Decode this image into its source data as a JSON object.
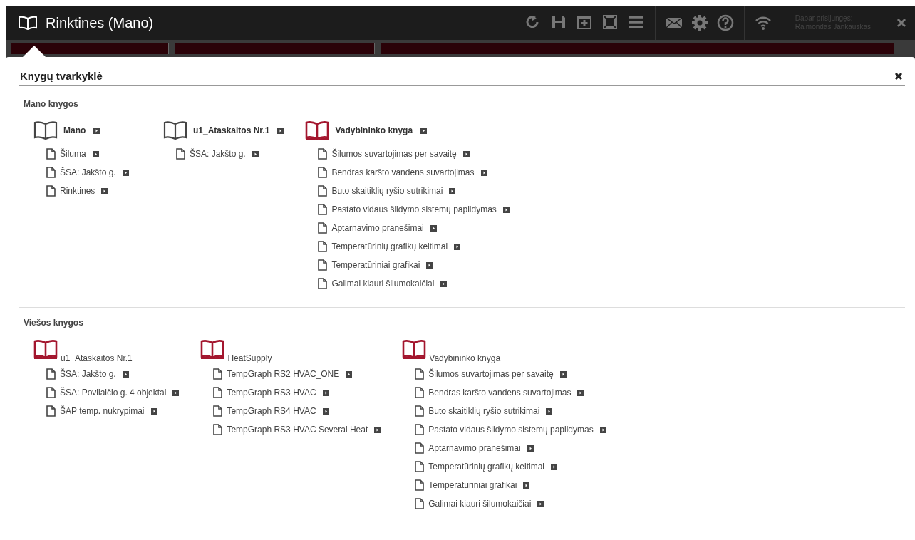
{
  "window": {
    "title": "Rinktines (Mano)"
  },
  "toolbar": {
    "buttons": [
      {
        "kind": "refresh"
      },
      {
        "kind": "save"
      },
      {
        "kind": "add"
      },
      {
        "kind": "fullscreen"
      },
      {
        "kind": "menu"
      },
      {
        "kind": "mail"
      },
      {
        "kind": "settings"
      },
      {
        "kind": "help"
      },
      {
        "kind": "wifi"
      }
    ],
    "user_label": "Dabar prisijungęs:",
    "user_name": "Raimondas Jankauskas"
  },
  "panel": {
    "title": "Knygų tvarkyklė",
    "sections": [
      {
        "title": "Mano knygos",
        "kind": "mine",
        "books": [
          {
            "title": "Mano",
            "kind": "plain",
            "pages": [
              "Šiluma",
              "ŠSA: Jakšto g.",
              "Rinktines"
            ]
          },
          {
            "title": "u1_Ataskaitos Nr.1",
            "kind": "plain",
            "pages": [
              "ŠSA: Jakšto g."
            ]
          },
          {
            "title": "Vadybininko knyga",
            "kind": "shared",
            "pages": [
              "Šilumos suvartojimas per savaitę",
              "Bendras karšto vandens suvartojimas",
              "Buto skaitiklių ryšio sutrikimai",
              "Pastato vidaus šildymo sistemų papildymas",
              "Aptarnavimo pranešimai",
              "Temperatūrinių grafikų keitimai",
              "Temperatūriniai grafikai",
              "Galimai kiauri šilumokaičiai"
            ]
          }
        ]
      },
      {
        "title": "Viešos knygos",
        "kind": "public",
        "books": [
          {
            "title": "u1_Ataskaitos Nr.1",
            "kind": "shared",
            "pages": [
              "ŠSA: Jakšto g.",
              "ŠSA: Povilaičio g. 4 objektai",
              "ŠAP temp. nukrypimai"
            ]
          },
          {
            "title": "HeatSupply",
            "kind": "shared",
            "pages": [
              "TempGraph RS2 HVAC_ONE",
              "TempGraph RS3 HVAC",
              "TempGraph RS4 HVAC",
              "TempGraph RS3 HVAC Several Heat"
            ]
          },
          {
            "title": "Vadybininko knyga",
            "kind": "shared",
            "pages": [
              "Šilumos suvartojimas per savaitę",
              "Bendras karšto vandens suvartojimas",
              "Buto skaitiklių ryšio sutrikimai",
              "Pastato vidaus šildymo sistemų papildymas",
              "Aptarnavimo pranešimai",
              "Temperatūrinių grafikų keitimai",
              "Temperatūriniai grafikai",
              "Galimai kiauri šilumokaičiai"
            ]
          }
        ]
      }
    ]
  }
}
